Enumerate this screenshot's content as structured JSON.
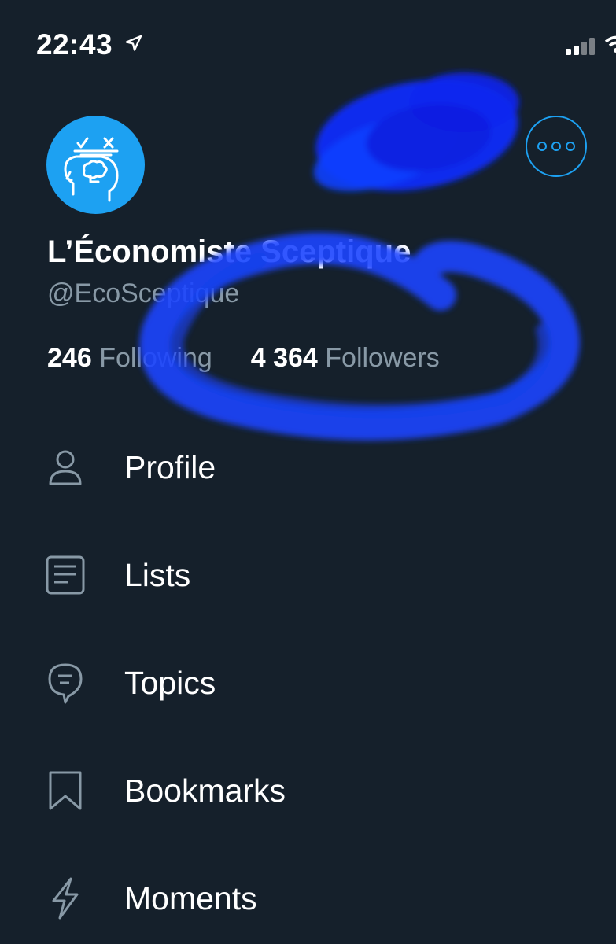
{
  "status_bar": {
    "time": "22:43"
  },
  "profile": {
    "display_name": "L’Économiste Sceptique",
    "handle": "@EcoSceptique",
    "following_count": "246",
    "following_label": "Following",
    "followers_count": "4 364",
    "followers_label": "Followers"
  },
  "menu": {
    "items": [
      {
        "label": "Profile",
        "icon": "person-icon"
      },
      {
        "label": "Lists",
        "icon": "list-icon"
      },
      {
        "label": "Topics",
        "icon": "topics-icon"
      },
      {
        "label": "Bookmarks",
        "icon": "bookmark-icon"
      },
      {
        "label": "Moments",
        "icon": "lightning-icon"
      }
    ]
  },
  "colors": {
    "background": "#15202b",
    "accent": "#1da1f2",
    "secondary_text": "#8899a6",
    "scribble": "#1140ff"
  }
}
